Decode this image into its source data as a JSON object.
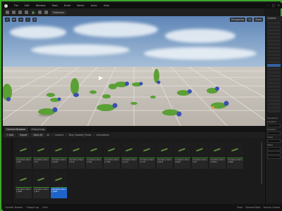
{
  "menu": {
    "items": [
      "File",
      "Edit",
      "Window",
      "Tools",
      "Build",
      "Select",
      "Actor",
      "Help"
    ]
  },
  "toolbar": {
    "mode_label": "Platforms"
  },
  "viewport": {
    "perspective": "Perspective",
    "lit": "Lit",
    "show": "Show"
  },
  "right_panel": {
    "tab": "Outliner",
    "detail_labels": [
      "Transform",
      "Location",
      "Rotation",
      "Scale",
      "Mesh"
    ]
  },
  "content_browser": {
    "tabs": [
      "Content Browser",
      "Output Log"
    ],
    "add_label": "+ Add",
    "import_label": "Import",
    "save_label": "Save All",
    "breadcrumb": [
      "All",
      "Content",
      "Blue_Headed_Parrot",
      "Animations"
    ],
    "assets": [
      {
        "label": "Animation Parrot_Eat"
      },
      {
        "label": "Animation Parrot_Fly"
      },
      {
        "label": "Animation Parrot_Glide"
      },
      {
        "label": "Animation Parrot_Hop"
      },
      {
        "label": "Animation Parrot_Idle"
      },
      {
        "label": "Animation Parrot_Idle2"
      },
      {
        "label": "Animation Parrot_Land"
      },
      {
        "label": "Animation Parrot_Look"
      },
      {
        "label": "Animation Parrot_Peck"
      },
      {
        "label": "Animation Parrot_Rest"
      },
      {
        "label": "Animation Parrot_Sit"
      },
      {
        "label": "Animation Parrot_Sleep"
      },
      {
        "label": "Animation Parrot_Take"
      },
      {
        "label": "Animation Parrot_Walk"
      },
      {
        "label": "Animation Parrot_Turn"
      },
      {
        "label": "Animation Parrot_Walk"
      }
    ],
    "selected_index": 15
  },
  "statusbar": {
    "items": [
      "Content Drawer",
      "Output Log",
      "Cmd"
    ],
    "right": [
      "Trace",
      "Derived Data",
      "Source Control"
    ]
  },
  "colors": {
    "accent": "#3ea82b",
    "select": "#1f63c9"
  }
}
